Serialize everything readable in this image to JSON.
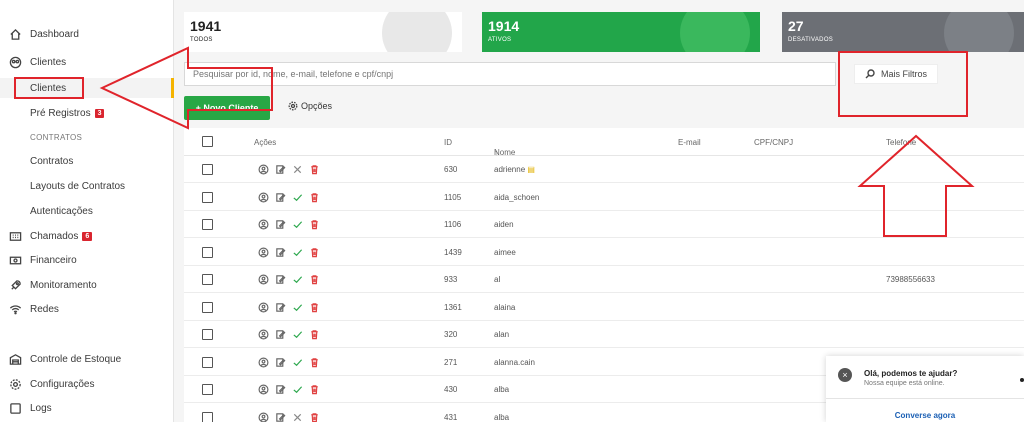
{
  "sidebar": {
    "dashboard": "Dashboard",
    "clientes_group": "Clientes",
    "clientes": "Clientes",
    "pre_registros": "Pré Registros",
    "pre_registros_badge": "3",
    "contratos_section": "CONTRATOS",
    "contratos": "Contratos",
    "layouts": "Layouts de Contratos",
    "autenticacoes": "Autenticações",
    "chamados": "Chamados",
    "chamados_badge": "6",
    "financeiro": "Financeiro",
    "monitoramento": "Monitoramento",
    "redes": "Redes",
    "estoque": "Controle de Estoque",
    "configuracoes": "Configurações",
    "logs": "Logs"
  },
  "stats": {
    "todos_count": "1941",
    "todos_label": "TODOS",
    "ativos_count": "1914",
    "ativos_label": "ATIVOS",
    "desativados_count": "27",
    "desativados_label": "DESATIVADOS"
  },
  "search": {
    "placeholder": "Pesquisar por id, nome, e-mail, telefone e cpf/cnpj"
  },
  "filters": {
    "more_label": "Mais Filtros"
  },
  "toolbar": {
    "new_client": "+ Novo Cliente",
    "options": "Opções"
  },
  "table": {
    "headers": {
      "actions": "Ações",
      "id": "ID",
      "name": "Nome",
      "email": "E-mail",
      "cpf": "CPF/CNPJ",
      "phone": "Telefone"
    },
    "rows": [
      {
        "id": "630",
        "name": "adrienne",
        "phone": "",
        "status": "x"
      },
      {
        "id": "1105",
        "name": "aida_schoen",
        "phone": "",
        "status": "ok"
      },
      {
        "id": "1106",
        "name": "aiden",
        "phone": "",
        "status": "ok"
      },
      {
        "id": "1439",
        "name": "aimee",
        "phone": "",
        "status": "ok"
      },
      {
        "id": "933",
        "name": "al",
        "phone": "73988556633",
        "status": "ok"
      },
      {
        "id": "1361",
        "name": "alaina",
        "phone": "",
        "status": "ok"
      },
      {
        "id": "320",
        "name": "alan",
        "phone": "",
        "status": "ok"
      },
      {
        "id": "271",
        "name": "alanna.cain",
        "phone": "",
        "status": "ok"
      },
      {
        "id": "430",
        "name": "alba",
        "phone": "",
        "status": "ok"
      },
      {
        "id": "431",
        "name": "alba",
        "phone": "",
        "status": "x"
      }
    ]
  },
  "chat": {
    "title": "Olá, podemos te ajudar?",
    "subtitle": "Nossa equipe está online.",
    "cta": "Converse agora"
  },
  "colors": {
    "accent_green": "#28a745",
    "annotation_red": "#e0242b",
    "badge_red": "#d9252f",
    "active_marker": "#f5b400"
  }
}
